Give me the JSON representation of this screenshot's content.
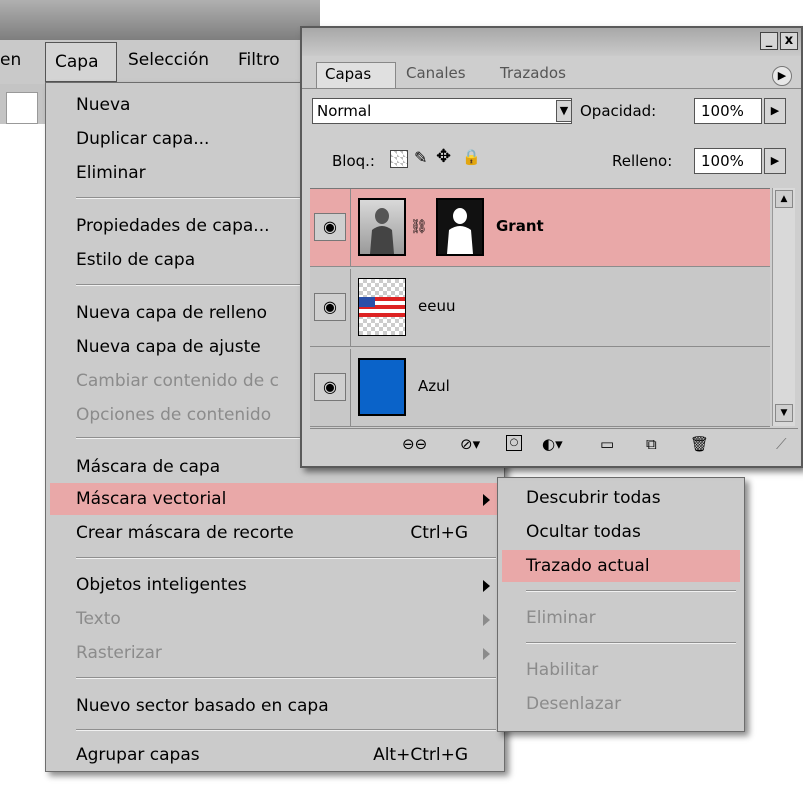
{
  "menubar": {
    "partial_item": "en",
    "capa": "Capa",
    "seleccion": "Selección",
    "filtro": "Filtro"
  },
  "menu": {
    "items": [
      {
        "label": "Nueva"
      },
      {
        "label": "Duplicar capa..."
      },
      {
        "label": "Eliminar"
      },
      {
        "label": "Propiedades de capa..."
      },
      {
        "label": "Estilo de capa"
      },
      {
        "label": "Nueva capa de relleno"
      },
      {
        "label": "Nueva capa de ajuste"
      },
      {
        "label": "Cambiar contenido de c"
      },
      {
        "label": "Opciones de contenido"
      },
      {
        "label": "Máscara de capa"
      },
      {
        "label": "Máscara vectorial"
      },
      {
        "label": "Crear máscara de recorte",
        "shortcut": "Ctrl+G"
      },
      {
        "label": "Objetos inteligentes"
      },
      {
        "label": "Texto"
      },
      {
        "label": "Rasterizar"
      },
      {
        "label": "Nuevo sector basado en capa"
      },
      {
        "label": "Agrupar capas",
        "shortcut": "Alt+Ctrl+G"
      }
    ]
  },
  "submenu": {
    "items": [
      {
        "label": "Descubrir todas"
      },
      {
        "label": "Ocultar todas"
      },
      {
        "label": "Trazado actual"
      },
      {
        "label": "Eliminar"
      },
      {
        "label": "Habilitar"
      },
      {
        "label": "Desenlazar"
      }
    ]
  },
  "panel": {
    "tabs": [
      "Capas",
      "Canales",
      "Trazados"
    ],
    "blend_mode": "Normal",
    "opacity_label": "Opacidad:",
    "opacity_value": "100%",
    "lock_label": "Bloq.:",
    "fill_label": "Relleno:",
    "fill_value": "100%",
    "layers": [
      {
        "name": "Grant"
      },
      {
        "name": "eeuu"
      },
      {
        "name": "Azul"
      }
    ],
    "window_buttons": {
      "minimize": "_",
      "close": "x"
    }
  },
  "colors": {
    "highlight": "#e9a8a8",
    "menu_bg": "#cbcbcb",
    "disabled_text": "#8b8b8b",
    "layer_blue": "#0a63c9"
  }
}
